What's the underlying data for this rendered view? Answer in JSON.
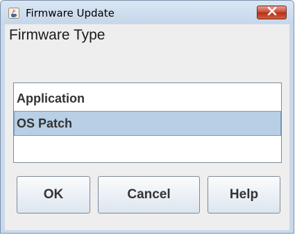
{
  "window": {
    "title": "Firmware Update",
    "app_icon": "java-cup-icon",
    "close_icon": "close-x-icon"
  },
  "section": {
    "label": "Firmware Type"
  },
  "list": {
    "items": [
      {
        "label": "Application",
        "selected": false
      },
      {
        "label": "OS Patch",
        "selected": true
      }
    ]
  },
  "buttons": {
    "ok_label": "OK",
    "cancel_label": "Cancel",
    "help_label": "Help"
  },
  "colors": {
    "selection": "#b8cfe5",
    "close_button": "#c8452f",
    "titlebar": "#c9d9ec"
  }
}
